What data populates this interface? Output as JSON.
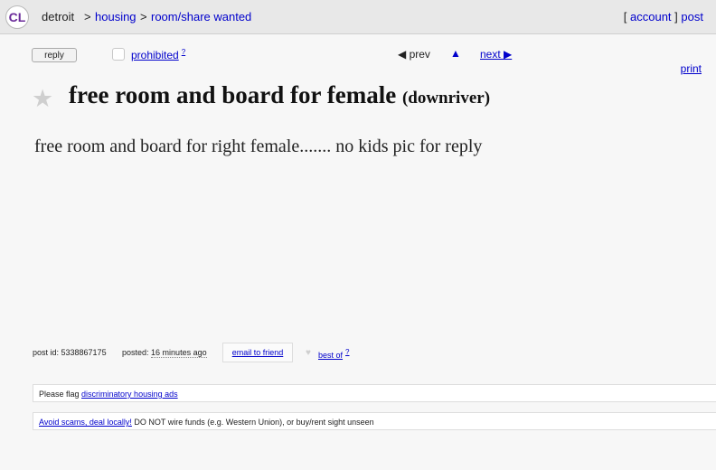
{
  "header": {
    "logo": "CL",
    "city": "detroit",
    "sep1": ">",
    "category": "housing",
    "sep2": ">",
    "subcategory": "room/share wanted",
    "bracket_open": "[",
    "account": "account",
    "bracket_close": "]",
    "post": "post"
  },
  "actions": {
    "reply": "reply",
    "prohibited": "prohibited",
    "help_mark": "?",
    "prev": "◀ prev",
    "up": "▲",
    "next": "next ▶",
    "print": "print"
  },
  "posting": {
    "star": "★",
    "title": "free room and board for female",
    "location": "(downriver)",
    "body": "free room and board for right female....... no kids pic for reply"
  },
  "info": {
    "post_id": "post id: 5338867175",
    "posted_label": "posted:",
    "posted_time": "16 minutes ago",
    "email_friend": "email to friend",
    "heart": "♥",
    "best_of": "best of",
    "best_help": "?"
  },
  "notices": {
    "flag_prefix": "Please flag",
    "flag_link": "discriminatory housing ads",
    "scam_link": "Avoid scams, deal locally!",
    "scam_text": " DO NOT wire funds (e.g. Western Union), or buy/rent sight unseen"
  },
  "colors": {
    "link": "#0000cc",
    "logo": "#6a2a99",
    "background": "#f7f7f7"
  }
}
